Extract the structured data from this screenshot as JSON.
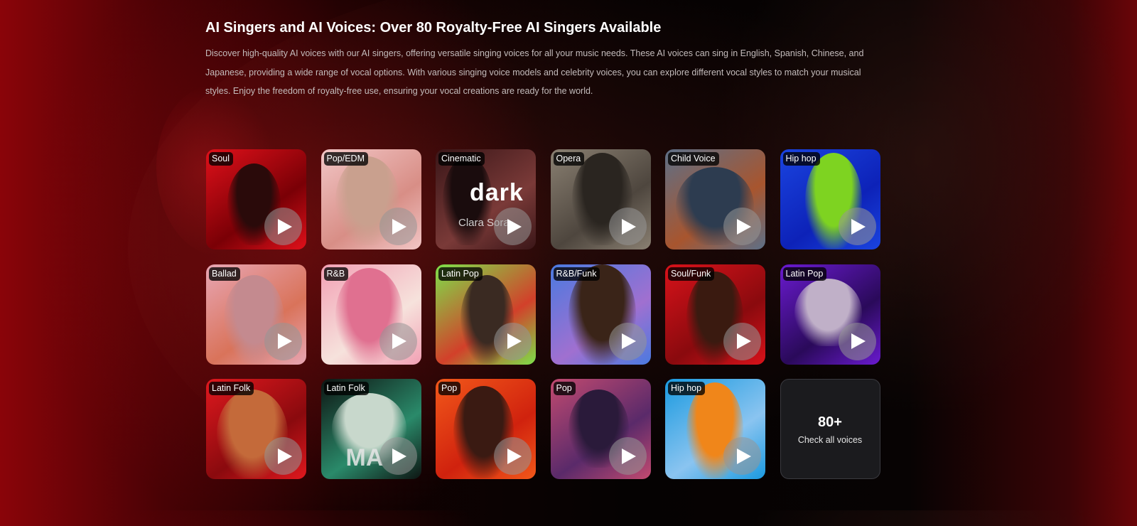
{
  "section": {
    "title": "AI Singers and AI Voices: Over 80 Royalty-Free AI Singers Available",
    "description": "Discover high-quality AI voices with our AI singers, offering versatile singing voices for all your music needs. These AI voices can sing in English, Spanish, Chinese, and Japanese, providing a wide range of vocal options. With various singing voice models and celebrity voices, you can explore different vocal styles to match your musical styles. Enjoy the freedom of royalty-free use, ensuring your vocal creations are ready for the world."
  },
  "voices": [
    {
      "tag": "Soul",
      "icon": "play-icon",
      "colors": [
        "#e0101a",
        "#7a0006",
        "#2a0a0a"
      ]
    },
    {
      "tag": "Pop/EDM",
      "icon": "play-icon",
      "colors": [
        "#f2c6c6",
        "#d88e86",
        "#c9a08e"
      ]
    },
    {
      "tag": "Cinematic",
      "icon": "play-icon",
      "colors": [
        "#3a1618",
        "#7a3a38",
        "#1a0c0d"
      ],
      "overlay_big": "dark",
      "overlay_small": "Clara Sora"
    },
    {
      "tag": "Opera",
      "icon": "play-icon",
      "colors": [
        "#8a8072",
        "#4e463e",
        "#2a2520"
      ]
    },
    {
      "tag": "Child Voice",
      "icon": "play-icon",
      "colors": [
        "#5d7088",
        "#a8552e",
        "#2d3c50"
      ]
    },
    {
      "tag": "Hip hop",
      "icon": "play-icon",
      "colors": [
        "#1a44e0",
        "#0d22b8",
        "#7ed321"
      ]
    },
    {
      "tag": "Ballad",
      "icon": "play-icon",
      "colors": [
        "#e8a6b4",
        "#d9735a",
        "#c48a8f"
      ]
    },
    {
      "tag": "R&B",
      "icon": "play-icon",
      "colors": [
        "#f2a0b4",
        "#f6e2dc",
        "#e07090"
      ]
    },
    {
      "tag": "Latin Pop",
      "icon": "play-icon",
      "colors": [
        "#7de04a",
        "#d2402a",
        "#3a2a22"
      ]
    },
    {
      "tag": "R&B/Funk",
      "icon": "play-icon",
      "colors": [
        "#4a7ae0",
        "#a070d0",
        "#3a2418"
      ]
    },
    {
      "tag": "Soul/Funk",
      "icon": "play-icon",
      "colors": [
        "#d8121a",
        "#8a0a0e",
        "#3a1a10"
      ]
    },
    {
      "tag": "Latin Pop",
      "icon": "play-icon",
      "colors": [
        "#6a1ad0",
        "#2a0a5a",
        "#c0b0c8"
      ]
    },
    {
      "tag": "Latin Folk",
      "icon": "play-icon",
      "colors": [
        "#e0181e",
        "#8a0a0e",
        "#c46a3a"
      ]
    },
    {
      "tag": "Latin Folk",
      "icon": "play-icon",
      "colors": [
        "#0e1412",
        "#2a8a6a",
        "#c8d8cc"
      ],
      "overlay_big": "MA",
      "overlay_small": ""
    },
    {
      "tag": "Pop",
      "icon": "play-icon",
      "colors": [
        "#f2581a",
        "#d0220e",
        "#3a1a12"
      ]
    },
    {
      "tag": "Pop",
      "icon": "play-icon",
      "colors": [
        "#c24a70",
        "#5a2a6a",
        "#2a1a3a"
      ]
    },
    {
      "tag": "Hip hop",
      "icon": "play-icon",
      "colors": [
        "#1a9ae0",
        "#8ac4f0",
        "#f0861a"
      ]
    }
  ],
  "more": {
    "count": "80+",
    "label": "Check all voices"
  }
}
